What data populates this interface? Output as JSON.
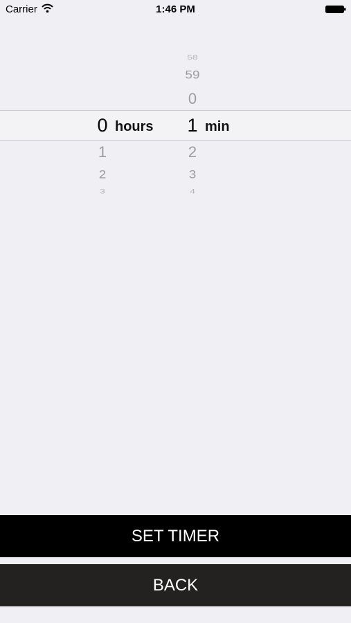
{
  "status_bar": {
    "carrier": "Carrier",
    "time": "1:46 PM",
    "icons": [
      "wifi-icon",
      "battery-icon"
    ]
  },
  "picker": {
    "hours": {
      "above": [],
      "selected": "0",
      "below": [
        "1",
        "2",
        "3"
      ],
      "unit": "hours"
    },
    "minutes": {
      "above": [
        "58",
        "59",
        "0"
      ],
      "selected": "1",
      "below": [
        "2",
        "3",
        "4"
      ],
      "unit": "min"
    }
  },
  "buttons": {
    "set_timer": "SET TIMER",
    "back": "BACK"
  },
  "colors": {
    "background": "#efeff4",
    "set_timer_bg": "#000000",
    "back_bg": "#232221",
    "button_text": "#ffffff",
    "picker_fade": "#9d9da1"
  }
}
